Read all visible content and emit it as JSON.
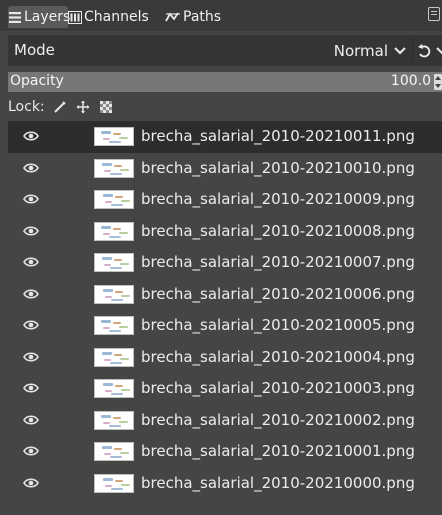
{
  "tabs": [
    {
      "label": "Layers",
      "icon": "layers-icon",
      "active": true
    },
    {
      "label": "Channels",
      "icon": "channels-icon",
      "active": false
    },
    {
      "label": "Paths",
      "icon": "paths-icon",
      "active": false
    }
  ],
  "mode": {
    "label": "Mode",
    "value": "Normal"
  },
  "opacity": {
    "label": "Opacity",
    "value": "100.0",
    "fraction": 1.0
  },
  "lock": {
    "label": "Lock:",
    "buttons": [
      "lock-pixels-icon",
      "lock-position-icon",
      "lock-alpha-icon"
    ]
  },
  "layers": [
    {
      "name": "brecha_salarial_2010-20210011.png",
      "visible": true,
      "selected": true
    },
    {
      "name": "brecha_salarial_2010-20210010.png",
      "visible": true,
      "selected": false
    },
    {
      "name": "brecha_salarial_2010-20210009.png",
      "visible": true,
      "selected": false
    },
    {
      "name": "brecha_salarial_2010-20210008.png",
      "visible": true,
      "selected": false
    },
    {
      "name": "brecha_salarial_2010-20210007.png",
      "visible": true,
      "selected": false
    },
    {
      "name": "brecha_salarial_2010-20210006.png",
      "visible": true,
      "selected": false
    },
    {
      "name": "brecha_salarial_2010-20210005.png",
      "visible": true,
      "selected": false
    },
    {
      "name": "brecha_salarial_2010-20210004.png",
      "visible": true,
      "selected": false
    },
    {
      "name": "brecha_salarial_2010-20210003.png",
      "visible": true,
      "selected": false
    },
    {
      "name": "brecha_salarial_2010-20210002.png",
      "visible": true,
      "selected": false
    },
    {
      "name": "brecha_salarial_2010-20210001.png",
      "visible": true,
      "selected": false
    },
    {
      "name": "brecha_salarial_2010-20210000.png",
      "visible": true,
      "selected": false
    }
  ],
  "colors": {
    "panel_bg": "#454545",
    "tab_bar_bg": "#3a3a3a",
    "selected_row_bg": "#2d2d2d",
    "opacity_bar_bg": "#6f6f6f",
    "text": "#ececec"
  }
}
